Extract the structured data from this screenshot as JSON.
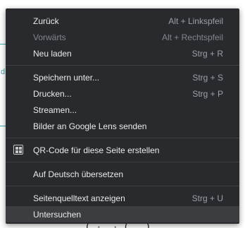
{
  "background": {
    "glyph_left": "d"
  },
  "menu": {
    "groups": [
      [
        {
          "label": "Zurück",
          "shortcut": "Alt + Linkspfeil",
          "disabled": false
        },
        {
          "label": "Vorwärts",
          "shortcut": "Alt + Rechtspfeil",
          "disabled": true
        },
        {
          "label": "Neu laden",
          "shortcut": "Strg + R",
          "disabled": false
        }
      ],
      [
        {
          "label": "Speichern unter...",
          "shortcut": "Strg + S",
          "disabled": false
        },
        {
          "label": "Drucken...",
          "shortcut": "Strg + P",
          "disabled": false
        },
        {
          "label": "Streamen...",
          "shortcut": "",
          "disabled": false
        },
        {
          "label": "Bilder an Google Lens senden",
          "shortcut": "",
          "disabled": false
        }
      ],
      [
        {
          "label": "QR-Code für diese Seite erstellen",
          "shortcut": "",
          "icon": "qr-code-icon",
          "disabled": false
        }
      ],
      [
        {
          "label": "Auf Deutsch übersetzen",
          "shortcut": "",
          "disabled": false
        }
      ],
      [
        {
          "label": "Seitenquelltext anzeigen",
          "shortcut": "Strg + U",
          "disabled": false
        },
        {
          "label": "Untersuchen",
          "shortcut": "",
          "disabled": false,
          "hovered": true
        }
      ]
    ]
  },
  "colors": {
    "menu_bg": "#292a2d",
    "text": "#e8eaed",
    "shortcut": "#9aa0a6",
    "disabled": "#80868b",
    "hover": "#3c3d41",
    "page_accent": "#3aa7b5"
  }
}
